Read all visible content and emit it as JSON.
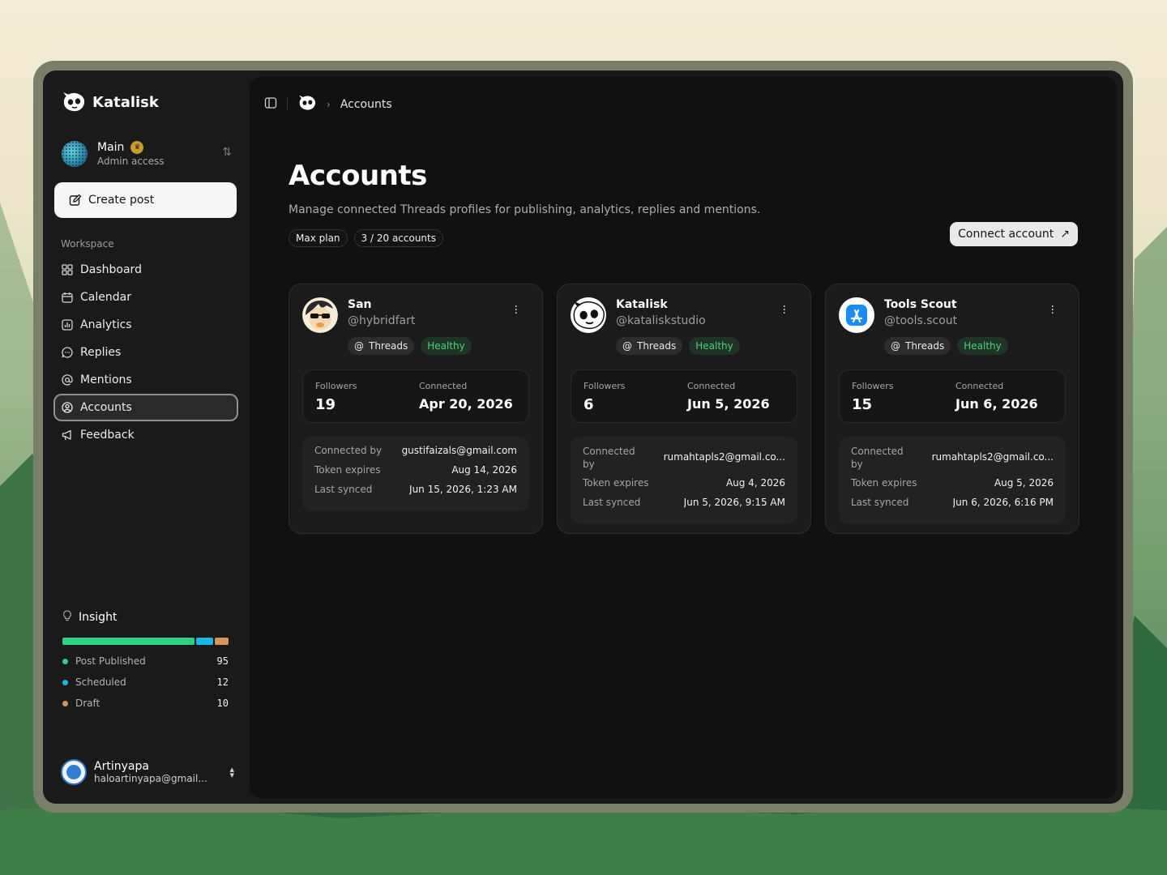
{
  "brand": {
    "name": "Katalisk"
  },
  "workspace_switcher": {
    "name": "Main",
    "role": "Admin access"
  },
  "create_post": {
    "label": "Create post"
  },
  "sidebar": {
    "section_label": "Workspace",
    "items": [
      {
        "label": "Dashboard",
        "icon": "grid-icon"
      },
      {
        "label": "Calendar",
        "icon": "calendar-icon"
      },
      {
        "label": "Analytics",
        "icon": "analytics-icon"
      },
      {
        "label": "Replies",
        "icon": "chat-bubble-icon"
      },
      {
        "label": "Mentions",
        "icon": "at-sign-icon"
      },
      {
        "label": "Accounts",
        "icon": "user-circle-icon",
        "active": true
      },
      {
        "label": "Feedback",
        "icon": "megaphone-icon"
      }
    ]
  },
  "insight": {
    "title": "Insight",
    "rows": [
      {
        "label": "Post Published",
        "value": "95",
        "color": "#2fcf84"
      },
      {
        "label": "Scheduled",
        "value": "12",
        "color": "#1bb7e6"
      },
      {
        "label": "Draft",
        "value": "10",
        "color": "#d4955c"
      }
    ]
  },
  "user": {
    "name": "Artinyapa",
    "email": "haloartinyapa@gmail..."
  },
  "breadcrumb": {
    "current": "Accounts"
  },
  "page": {
    "title": "Accounts",
    "description": "Manage connected Threads profiles for publishing, analytics, replies and mentions.",
    "plan_chip": "Max plan",
    "accounts_chip": "3 / 20 accounts",
    "connect_label": "Connect account"
  },
  "labels": {
    "followers": "Followers",
    "connected": "Connected",
    "connected_by": "Connected by",
    "connected_by_split": "Connected by",
    "token_expires": "Token expires",
    "last_synced": "Last synced",
    "threads": "Threads",
    "healthy": "Healthy"
  },
  "accounts": [
    {
      "name": "San",
      "handle": "@hybridfart",
      "platform": "Threads",
      "status": "Healthy",
      "followers": "19",
      "connected": "Apr 20, 2026",
      "connected_by": "gustifaizals@gmail.com",
      "token_expires": "Aug 14, 2026",
      "last_synced": "Jun 15, 2026, 1:23 AM"
    },
    {
      "name": "Katalisk",
      "handle": "@kataliskstudio",
      "platform": "Threads",
      "status": "Healthy",
      "followers": "6",
      "connected": "Jun 5, 2026",
      "connected_by": "rumahtapls2@gmail.co...",
      "token_expires": "Aug 4, 2026",
      "last_synced": "Jun 5, 2026, 9:15 AM"
    },
    {
      "name": "Tools Scout",
      "handle": "@tools.scout",
      "platform": "Threads",
      "status": "Healthy",
      "followers": "15",
      "connected": "Jun 6, 2026",
      "connected_by": "rumahtapls2@gmail.co...",
      "token_expires": "Aug 5, 2026",
      "last_synced": "Jun 6, 2026, 6:16 PM"
    }
  ]
}
